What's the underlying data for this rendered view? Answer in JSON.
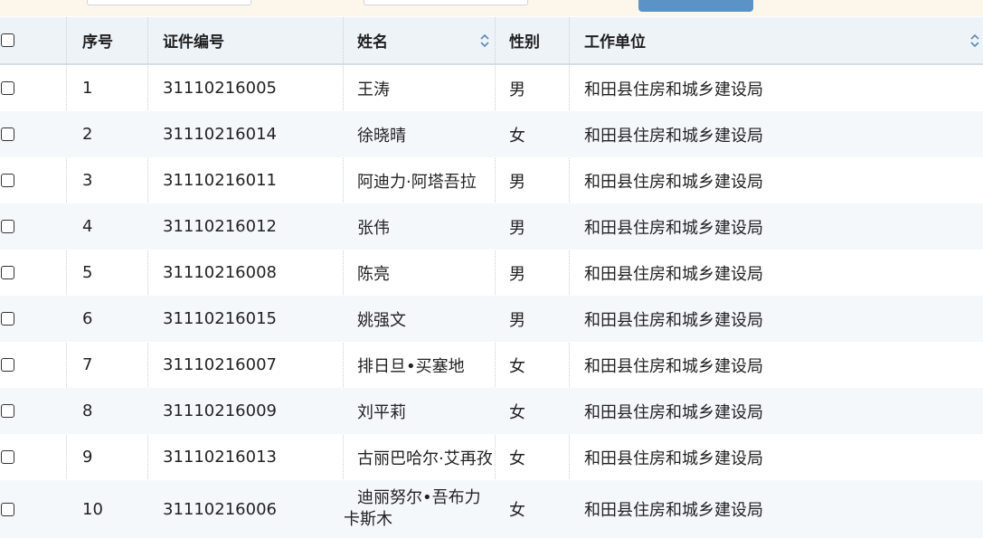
{
  "header": {
    "seq": "序号",
    "id_no": "证件编号",
    "name": "姓名",
    "gender": "性别",
    "unit": "工作单位",
    "name_sort_icon": "sort-toggle-icon",
    "unit_sort_icon": "sort-toggle-icon"
  },
  "colors": {
    "accent": "#5b93c7",
    "header_bg": "#eef3f8",
    "topbar_bg": "#fdf6ea",
    "row_alt": "#f5f8fb"
  },
  "rows": [
    {
      "seq": "1",
      "id_no": "31110216005",
      "name": "王涛",
      "gender": "男",
      "unit": "和田县住房和城乡建设局"
    },
    {
      "seq": "2",
      "id_no": "31110216014",
      "name": "徐晓晴",
      "gender": "女",
      "unit": "和田县住房和城乡建设局"
    },
    {
      "seq": "3",
      "id_no": "31110216011",
      "name": "阿迪力·阿塔吾拉",
      "gender": "男",
      "unit": "和田县住房和城乡建设局"
    },
    {
      "seq": "4",
      "id_no": "31110216012",
      "name": "张伟",
      "gender": "男",
      "unit": "和田县住房和城乡建设局"
    },
    {
      "seq": "5",
      "id_no": "31110216008",
      "name": "陈亮",
      "gender": "男",
      "unit": "和田县住房和城乡建设局"
    },
    {
      "seq": "6",
      "id_no": "31110216015",
      "name": "姚强文",
      "gender": "男",
      "unit": "和田县住房和城乡建设局"
    },
    {
      "seq": "7",
      "id_no": "31110216007",
      "name": "排日旦•买塞地",
      "gender": "女",
      "unit": "和田县住房和城乡建设局"
    },
    {
      "seq": "8",
      "id_no": "31110216009",
      "name": "刘平莉",
      "gender": "女",
      "unit": "和田县住房和城乡建设局"
    },
    {
      "seq": "9",
      "id_no": "31110216013",
      "name": "古丽巴哈尔·艾再孜",
      "gender": "女",
      "unit": "和田县住房和城乡建设局"
    },
    {
      "seq": "10",
      "id_no": "31110216006",
      "name_line1": "迪丽努尔•吾布力",
      "name_line2": "卡斯木",
      "gender": "女",
      "unit": "和田县住房和城乡建设局"
    }
  ]
}
